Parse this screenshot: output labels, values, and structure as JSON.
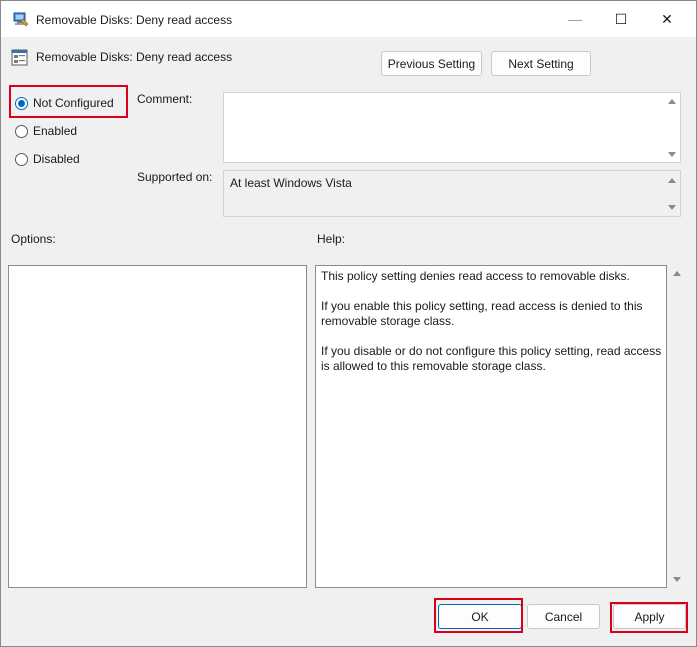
{
  "window": {
    "title": "Removable Disks: Deny read access",
    "controls": {
      "minimize": "—",
      "maximize": "☐",
      "close": "✕"
    }
  },
  "header": {
    "title": "Removable Disks: Deny read access",
    "previous_label": "Previous Setting",
    "next_label": "Next Setting"
  },
  "state": {
    "options": [
      {
        "label": "Not Configured",
        "checked": true
      },
      {
        "label": "Enabled",
        "checked": false
      },
      {
        "label": "Disabled",
        "checked": false
      }
    ]
  },
  "comment": {
    "label": "Comment:",
    "value": ""
  },
  "supported": {
    "label": "Supported on:",
    "value": "At least Windows Vista"
  },
  "options_panel": {
    "label": "Options:"
  },
  "help_panel": {
    "label": "Help:",
    "paragraphs": [
      "This policy setting denies read access to removable disks.",
      "If you enable this policy setting, read access is denied to this removable storage class.",
      "If you disable or do not configure this policy setting, read access is allowed to this removable storage class."
    ]
  },
  "footer": {
    "ok_label": "OK",
    "cancel_label": "Cancel",
    "apply_label": "Apply"
  },
  "colors": {
    "accent": "#0067c0",
    "highlight": "#d9001b"
  },
  "icons": {
    "app": "policy-editor-icon",
    "header": "policy-setting-icon"
  }
}
